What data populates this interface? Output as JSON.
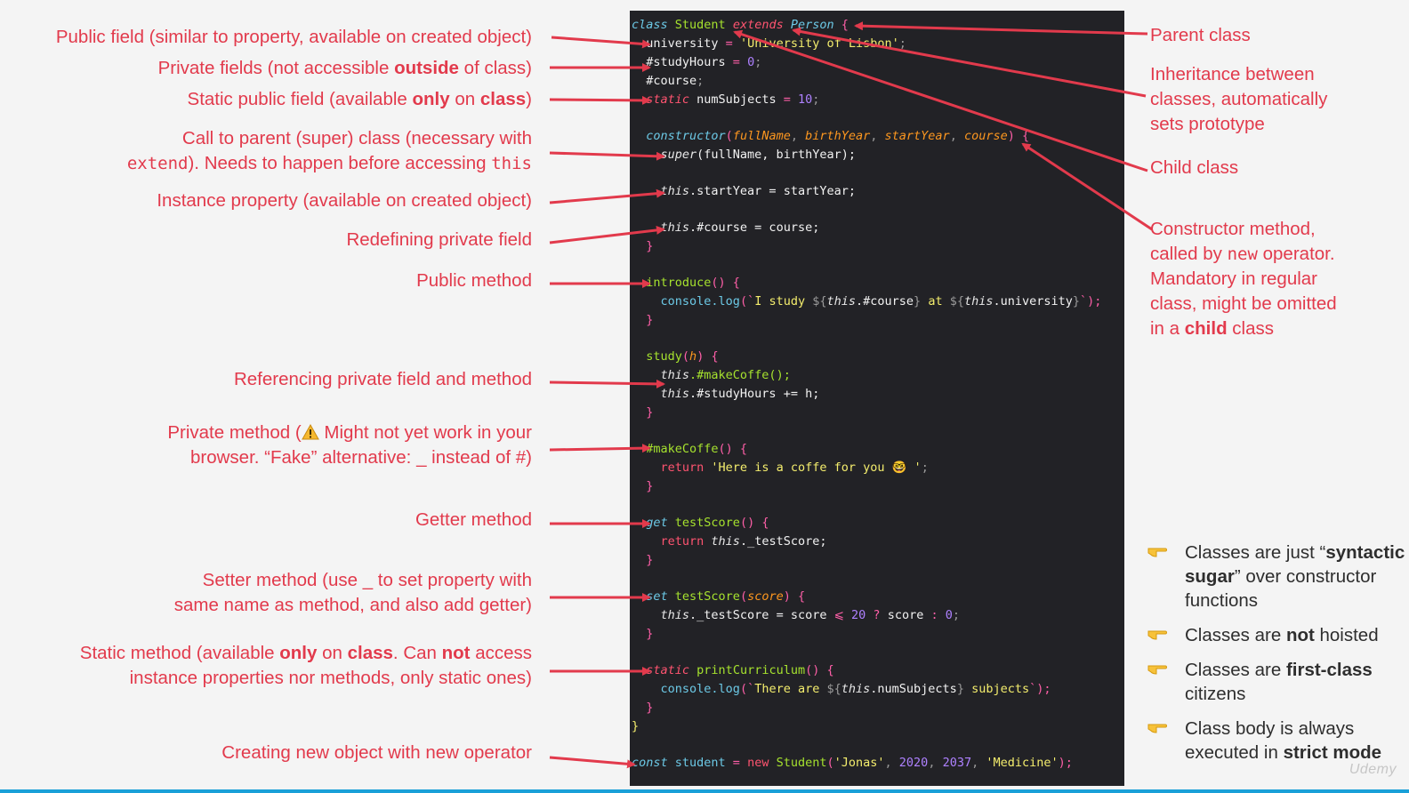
{
  "code": {
    "l1_class": "class",
    "l1_name": "Student",
    "l1_extends": "extends",
    "l1_parent": "Person",
    "l1_brace": "{",
    "l2_prop": "university",
    "l2_eq": " = ",
    "l2_val": "'University of Lisbon'",
    "l2_semi": ";",
    "l3_prop": "#studyHours",
    "l3_eq": " = ",
    "l3_val": "0",
    "l3_semi": ";",
    "l4_prop": "#course",
    "l4_semi": ";",
    "l5_static": "static",
    "l5_prop": " numSubjects",
    "l5_eq": " = ",
    "l5_val": "10",
    "l5_semi": ";",
    "l7_ctor": "constructor",
    "l7_open": "(",
    "l7_p1": "fullName",
    "l7_p2": "birthYear",
    "l7_p3": "startYear",
    "l7_p4": "course",
    "l7_close": ") {",
    "l8_super": "super",
    "l8_args": "(fullName, birthYear);",
    "l10_this": "this",
    "l10_rest": ".startYear = startYear;",
    "l12_this": "this",
    "l12_rest": ".#course = course;",
    "l13": "}",
    "l15_fn": "introduce",
    "l15_rest": "() {",
    "l16_console": "console.",
    "l16_log": "log",
    "l16_open": "(`",
    "l16_s1": "I study ",
    "l16_i1a": "${",
    "l16_i1t": "this",
    "l16_i1r": ".#course",
    "l16_i1b": "}",
    "l16_s2": " at ",
    "l16_i2a": "${",
    "l16_i2t": "this",
    "l16_i2r": ".university",
    "l16_i2b": "}",
    "l16_close": "`);",
    "l17": "}",
    "l19_fn": "study",
    "l19_open": "(",
    "l19_p": "h",
    "l19_close": ") {",
    "l20_this": "this",
    "l20_rest": ".#makeCoffe();",
    "l21_this": "this",
    "l21_rest": ".#studyHours += h;",
    "l22": "}",
    "l24_fn": "#makeCoffe",
    "l24_rest": "() {",
    "l25_ret": "return",
    "l25_str": " 'Here is a coffe for you 🤓 '",
    "l25_semi": ";",
    "l26": "}",
    "l28_get": "get",
    "l28_fn": " testScore",
    "l28_rest": "() {",
    "l29_ret": "return",
    "l29_this": " this",
    "l29_rest": "._testScore;",
    "l30": "}",
    "l32_set": "set",
    "l32_fn": " testScore",
    "l32_open": "(",
    "l32_p": "score",
    "l32_close": ") {",
    "l33_this": "this",
    "l33_rest": "._testScore = score ",
    "l33_op": "⩽",
    "l33_num": " 20",
    "l33_q": " ?",
    "l33_mid": " score ",
    "l33_colon": ":",
    "l33_zero": " 0",
    "l33_semi": ";",
    "l34": "}",
    "l36_static": "static",
    "l36_fn": " printCurriculum",
    "l36_rest": "() {",
    "l37_console": "console.",
    "l37_log": "log",
    "l37_open": "(`",
    "l37_s1": "There are ",
    "l37_ia": "${",
    "l37_it": "this",
    "l37_ir": ".numSubjects",
    "l37_ib": "}",
    "l37_s2": " subjects",
    "l37_close": "`);",
    "l38": "}",
    "l39": "}",
    "l41_const": "const",
    "l41_var": " student",
    "l41_eq": " = ",
    "l41_new": "new",
    "l41_cls": " Student",
    "l41_open": "(",
    "l41_a1": "'Jonas'",
    "l41_c1": ", ",
    "l41_a2": "2020",
    "l41_c2": ", ",
    "l41_a3": "2037",
    "l41_c3": ", ",
    "l41_a4": "'Medicine'",
    "l41_close": ");"
  },
  "left_annotations": {
    "public_field": "Public field (similar to property, available on created object)",
    "private_fields_a": "Private fields (not accessible ",
    "private_fields_b": "outside",
    "private_fields_c": " of class)",
    "static_field_a": "Static public field (available ",
    "static_field_b": "only",
    "static_field_c": " on ",
    "static_field_d": "class",
    "static_field_e": ")",
    "super_l1": "Call to parent (super) class (necessary with",
    "super_l2a": "extend",
    "super_l2b": "). Needs to happen before accessing ",
    "super_l2c": "this",
    "instance_prop": "Instance property (available on created object)",
    "redefine_private": "Redefining private field",
    "public_method": "Public method",
    "ref_private": "Referencing private field and method",
    "private_method_l1a": "Private method (",
    "private_method_l1b": " Might not yet work in your",
    "private_method_l2": "browser. “Fake” alternative: _ instead of #)",
    "getter": "Getter method",
    "setter_l1": "Setter method (use _ to set property with",
    "setter_l2": "same name as method, and also add getter)",
    "static_method_l1a": "Static method (available ",
    "static_method_l1b": "only",
    "static_method_l1c": " on ",
    "static_method_l1d": "class",
    "static_method_l1e": ". Can ",
    "static_method_l1f": "not",
    "static_method_l1g": " access",
    "static_method_l2": "instance properties nor methods, only static ones)",
    "creating_object": "Creating new object with new operator"
  },
  "right_annotations": {
    "parent_class": "Parent class",
    "inheritance_l1": "Inheritance between",
    "inheritance_l2": "classes, automatically",
    "inheritance_l3": "sets prototype",
    "child_class": "Child class",
    "ctor_l1": "Constructor method,",
    "ctor_l2a": "called by ",
    "ctor_l2b": "new",
    "ctor_l2c": " operator.",
    "ctor_l3": "Mandatory in regular",
    "ctor_l4": "class, might be omitted",
    "ctor_l5a": "in a ",
    "ctor_l5b": "child",
    "ctor_l5c": " class"
  },
  "bullets": {
    "b1_a": "Classes are just “",
    "b1_b": "syntactic sugar",
    "b1_c": "” over constructor functions",
    "b2_a": "Classes are ",
    "b2_b": "not",
    "b2_c": " hoisted",
    "b3_a": "Classes are ",
    "b3_b": "first-class",
    "b3_c": " citizens",
    "b4_a": "Class body is always executed in ",
    "b4_b": "strict mode"
  },
  "icons": {
    "bullet": "pointing-hand-icon",
    "warning": "warning-icon"
  },
  "colors": {
    "accent_red": "#e23a4c",
    "code_bg": "#222226",
    "page_bg": "#f4f4f4",
    "bottom_bar": "#19a0d8"
  },
  "watermark": "Udemy"
}
